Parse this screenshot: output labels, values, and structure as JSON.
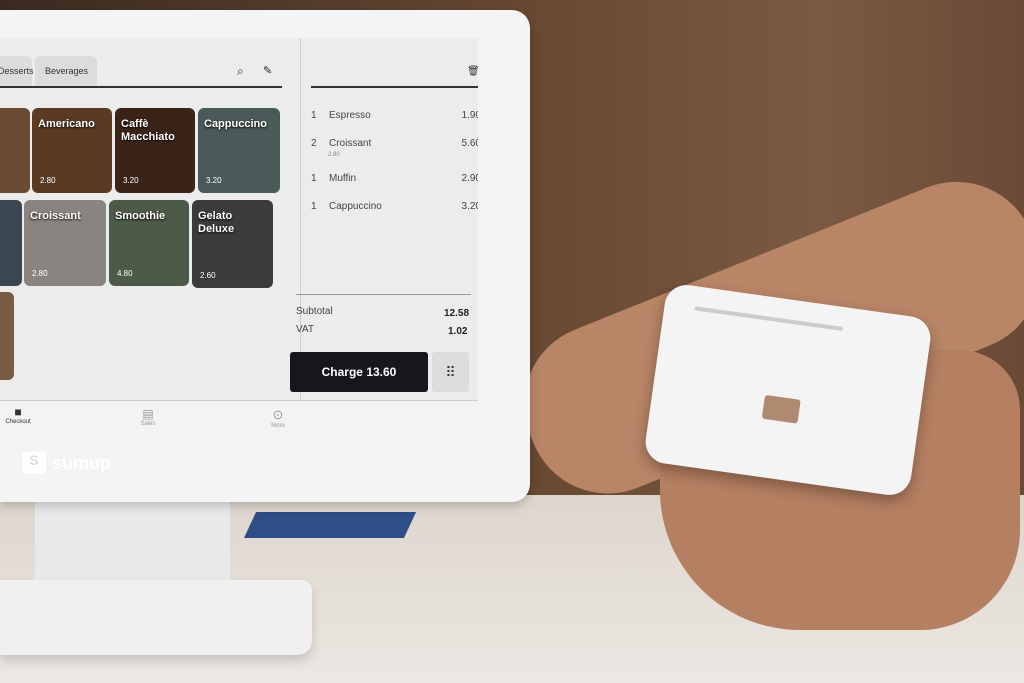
{
  "tabs": [
    "Desserts",
    "Beverages"
  ],
  "icons": [
    "search-icon",
    "edit-icon",
    "trash-icon",
    "wifi-icon",
    "keypad-icon"
  ],
  "products": [
    {
      "name": "Americano",
      "price": "2.80",
      "color": "#5a3a22"
    },
    {
      "name": "Caffè Macchiato",
      "price": "3.20",
      "color": "#3a2418"
    },
    {
      "name": "Cappuccino",
      "price": "3.20",
      "color": "#4a5a58"
    },
    {
      "name": "Croissant",
      "price": "2.80",
      "color": "#8a8480"
    },
    {
      "name": "Smoothie",
      "price": "4.80",
      "color": "#4d5a48"
    },
    {
      "name": "Gelato Deluxe",
      "price": "2.60",
      "color": "#3d3a3a"
    }
  ],
  "order": [
    {
      "qty": "1",
      "name": "Espresso",
      "price": "1.90"
    },
    {
      "qty": "2",
      "name": "Croissant",
      "unit": "2.80",
      "price": "5.60"
    },
    {
      "qty": "1",
      "name": "Muffin",
      "price": "2.90"
    },
    {
      "qty": "1",
      "name": "Cappuccino",
      "price": "3.20"
    }
  ],
  "totals": {
    "subtotal_label": "Subtotal",
    "subtotal": "12.58",
    "vat_label": "VAT",
    "vat": "1.02"
  },
  "charge_label": "Charge 13.60",
  "nav": [
    "Checkout",
    "Sales",
    "More"
  ],
  "brand": "sumup"
}
